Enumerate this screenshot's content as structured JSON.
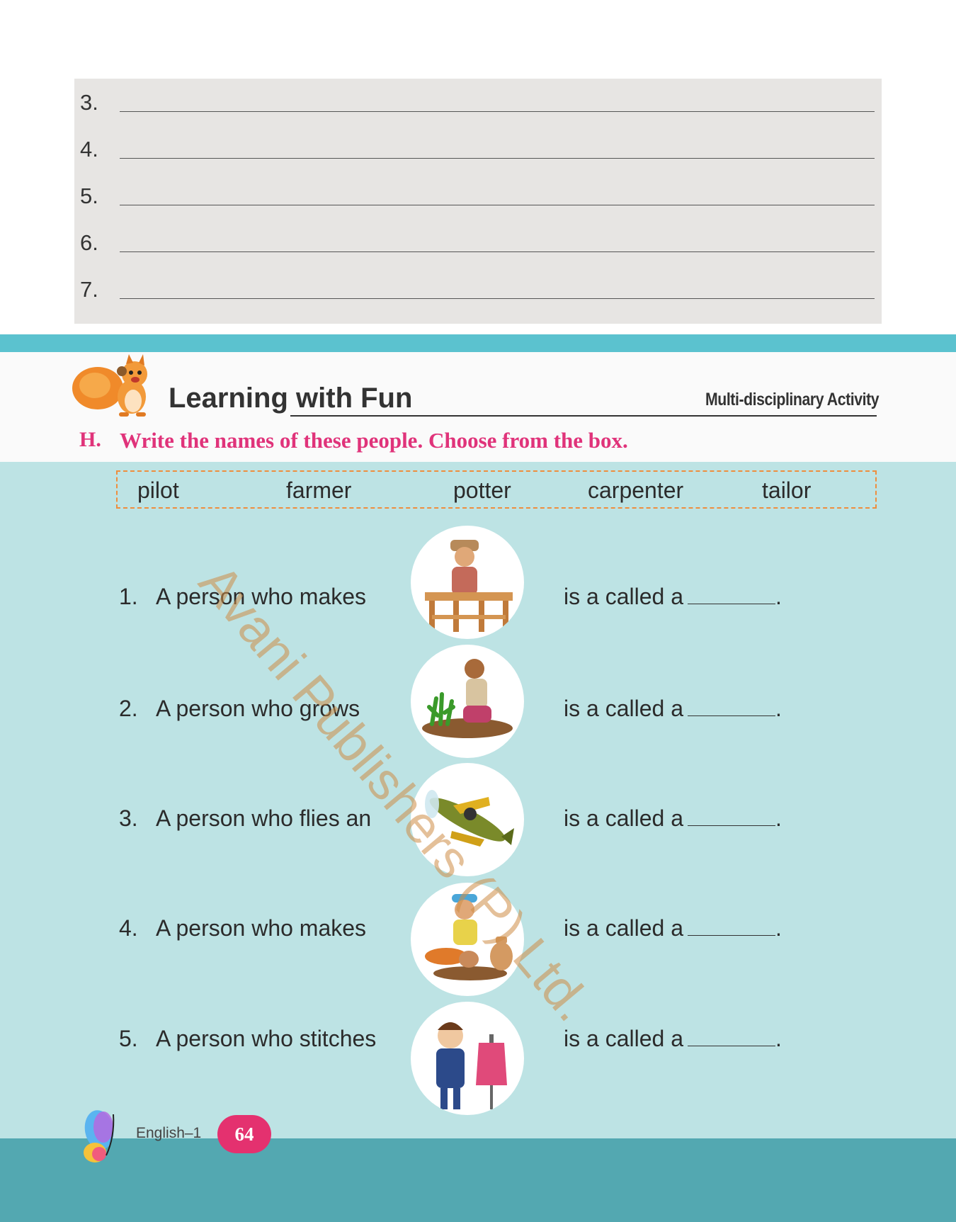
{
  "writing_lines": [
    "3.",
    "4.",
    "5.",
    "6.",
    "7."
  ],
  "header": {
    "title": "Learning with Fun",
    "tag": "Multi-disciplinary Activity"
  },
  "question": {
    "letter": "H.",
    "instruction": "Write the names of these people. Choose from the box."
  },
  "word_box": [
    "pilot",
    "farmer",
    "potter",
    "carpenter",
    "tailor"
  ],
  "items": [
    {
      "num": "1.",
      "text": "A person who makes",
      "tail": "is a called a",
      "end": ".",
      "icon": "carpenter-icon"
    },
    {
      "num": "2.",
      "text": "A person who grows",
      "tail": "is a called a",
      "end": ".",
      "icon": "farmer-icon"
    },
    {
      "num": "3.",
      "text": "A person who flies an",
      "tail": "is a called a",
      "end": ".",
      "icon": "airplane-icon"
    },
    {
      "num": "4.",
      "text": "A person who makes",
      "tail": "is a called a",
      "end": ".",
      "icon": "potter-icon"
    },
    {
      "num": "5.",
      "text": "A person who stitches",
      "tail": "is a called a",
      "end": ".",
      "icon": "tailor-icon"
    }
  ],
  "watermark": "Avani Publishers (P) Ltd.",
  "footer": {
    "book": "English–1",
    "page": "64"
  },
  "colors": {
    "panel": "#e7e5e3",
    "teal_band": "#5bc2cf",
    "body_blue": "#bde3e4",
    "footer_band": "#53a8b1",
    "accent_pink": "#e0337a",
    "box_border": "#ee8e3e"
  }
}
